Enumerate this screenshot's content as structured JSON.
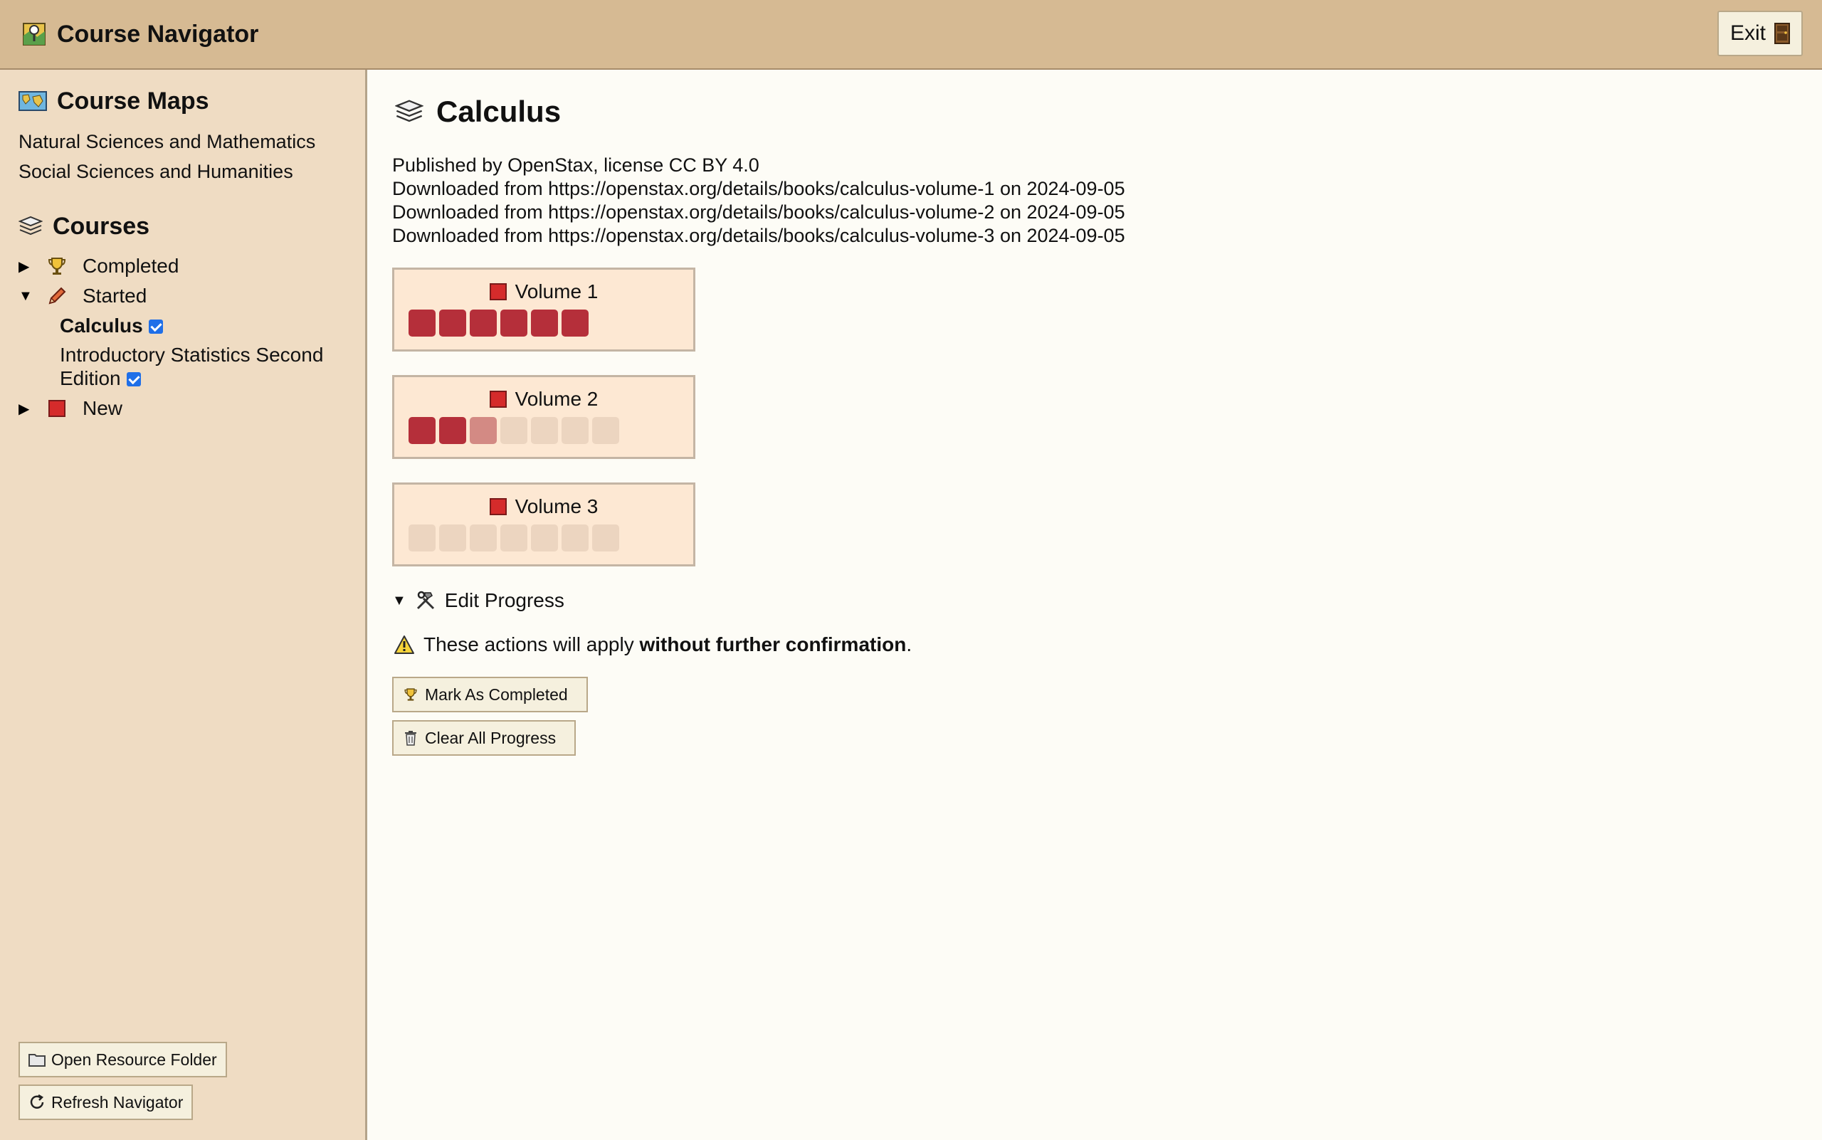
{
  "header": {
    "title": "Course Navigator",
    "exit_label": "Exit"
  },
  "sidebar": {
    "course_maps_heading": "Course Maps",
    "maps": [
      "Natural Sciences and Mathematics",
      "Social Sciences and Humanities"
    ],
    "courses_heading": "Courses",
    "groups": {
      "completed": "Completed",
      "started": "Started",
      "new": "New"
    },
    "started_items": {
      "calculus": "Calculus",
      "intro_stats_line1": "Introductory Statistics Second",
      "intro_stats_line2": "Edition"
    },
    "open_folder_label": "Open Resource Folder",
    "refresh_label": "Refresh Navigator"
  },
  "main": {
    "title": "Calculus",
    "info": [
      "Published by OpenStax, license CC BY 4.0",
      "Downloaded from https://openstax.org/details/books/calculus-volume-1 on 2024-09-05",
      "Downloaded from https://openstax.org/details/books/calculus-volume-2 on 2024-09-05",
      "Downloaded from https://openstax.org/details/books/calculus-volume-3 on 2024-09-05"
    ],
    "volumes": [
      {
        "label": "Volume 1",
        "segments": [
          "done",
          "done",
          "done",
          "done",
          "done",
          "done"
        ]
      },
      {
        "label": "Volume 2",
        "segments": [
          "done",
          "done",
          "partial",
          "empty",
          "empty",
          "empty",
          "empty"
        ]
      },
      {
        "label": "Volume 3",
        "segments": [
          "empty",
          "empty",
          "empty",
          "empty",
          "empty",
          "empty",
          "empty"
        ]
      }
    ],
    "edit_progress_label": "Edit Progress",
    "warning_prefix": "These actions will apply ",
    "warning_bold": "without further confirmation",
    "warning_suffix": ".",
    "mark_completed_label": "Mark As Completed",
    "clear_progress_label": "Clear All Progress"
  },
  "colors": {
    "header_bg": "#d6ba93",
    "sidebar_bg": "#efdcc3",
    "main_bg": "#fdfcf6",
    "segment_done": "#b52f3a",
    "segment_partial": "#d38a84",
    "segment_empty": "#ecd5c0",
    "checkbox": "#1f6fe8"
  }
}
